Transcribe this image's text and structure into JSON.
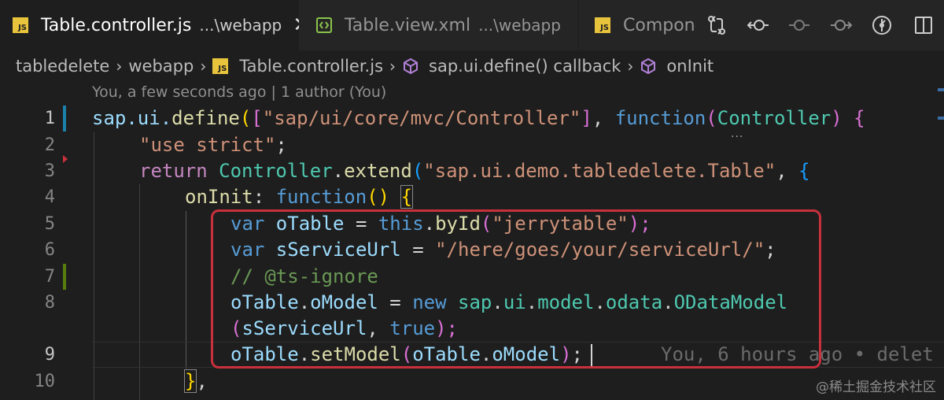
{
  "tabs": [
    {
      "label": "Table.controller.js",
      "path": "...\\webapp",
      "icon": "js-icon",
      "active": true
    },
    {
      "label": "Table.view.xml",
      "path": "...\\webapp",
      "icon": "xml-icon",
      "active": false
    },
    {
      "label": "Compone",
      "path": "",
      "icon": "js-icon",
      "active": false
    }
  ],
  "toolbar_icons": [
    "source-control-compare-icon",
    "go-back-icon",
    "commit-icon",
    "go-forward-icon",
    "git-history-icon",
    "split-editor-icon"
  ],
  "breadcrumb": {
    "folder1": "tabledelete",
    "folder2": "webapp",
    "file": "Table.controller.js",
    "symbol1": "sap.ui.define() callback",
    "symbol2": "onInit"
  },
  "blame_header": "You, a few seconds ago | 1 author (You)",
  "line_numbers": [
    "1",
    "2",
    "3",
    "4",
    "5",
    "6",
    "7",
    "8",
    "",
    "9",
    "10"
  ],
  "code": {
    "l1": {
      "a": "sap.ui.",
      "b": "define",
      "c": "(",
      "d": "[",
      "e": "\"sap/ui/core/mvc/Controller\"",
      "f": "]",
      ",": ", ",
      "g": "function",
      "h": "(",
      "i": "Controller",
      "j": ") ",
      "k": "{"
    },
    "l2": {
      "a": "\"use strict\"",
      "b": ";"
    },
    "l3": {
      "a": "return ",
      "b": "Controller",
      "c": ".",
      "d": "extend",
      "e": "(",
      "f": "\"sap.ui.demo.tabledelete.Table\"",
      "g": ", ",
      "h": "{"
    },
    "l4": {
      "a": "onInit",
      "b": ": ",
      "c": "function",
      "d": "()",
      "e": " ",
      "f": "{"
    },
    "l5": {
      "a": "var ",
      "b": "oTable",
      "c": " = ",
      "d": "this",
      "e": ".",
      "f": "byId",
      "g": "(",
      "h": "\"jerrytable\"",
      "i": ");"
    },
    "l6": {
      "a": "var ",
      "b": "sServiceUrl",
      "c": " = ",
      "d": "\"/here/goes/your/serviceUrl/\"",
      "e": ";"
    },
    "l7": {
      "a": "// @ts-ignore"
    },
    "l8": {
      "a": "oTable",
      "b": ".",
      "c": "oModel",
      "d": " = ",
      "e": "new ",
      "f": "sap",
      "g": ".",
      "h": "ui",
      "i": ".",
      "j": "model",
      "k": ".",
      "l": "odata",
      "m": ".",
      "n": "ODataModel"
    },
    "l8b": {
      "a": "(",
      "b": "sServiceUrl",
      "c": ", ",
      "d": "true",
      "e": ");"
    },
    "l9": {
      "a": "oTable",
      "b": ".",
      "c": "setModel",
      "d": "(",
      "e": "oTable",
      "f": ".",
      "g": "oModel",
      "h": ")",
      "i": ";"
    },
    "l10": {
      "a": "}",
      ",": ","
    }
  },
  "inline_blame": "You, 6 hours ago • delet",
  "watermark": "@稀土掘金技术社区",
  "colors": {
    "highlight_border": "#c8303c",
    "gutter_modified": "#1b81a8",
    "gutter_added": "#587c0c"
  }
}
